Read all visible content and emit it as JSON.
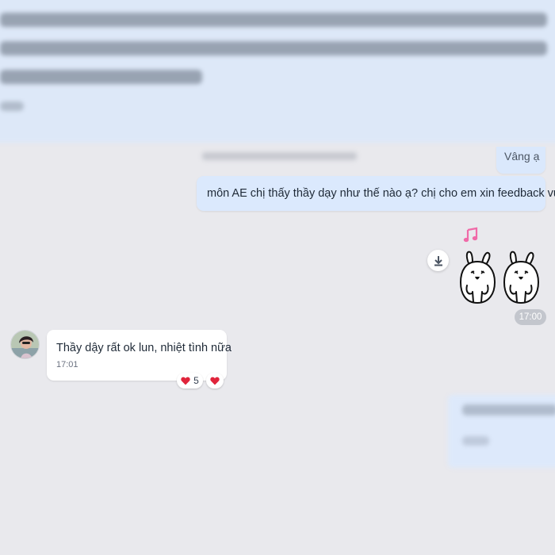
{
  "chat": {
    "outgoing_short": {
      "text": "Vâng ạ"
    },
    "outgoing_question": {
      "text": "môn AE chị thấy thầy dạy như thế nào ạ? chị cho em xin feedback vứi"
    },
    "sticker": {
      "time": "17:00",
      "icon": "download-icon"
    },
    "incoming": {
      "text": "Thầy dậy rất ok lun, nhiệt tình nữa",
      "time": "17:01",
      "reactions": [
        {
          "emoji": "heart",
          "count": "5"
        },
        {
          "emoji": "heart"
        }
      ]
    }
  },
  "colors": {
    "outgoing_bubble": "#dbe9fd",
    "incoming_bubble": "#ffffff",
    "background": "#e9e9ed",
    "heart": "#e0243b",
    "music_note": "#f06aa8"
  }
}
